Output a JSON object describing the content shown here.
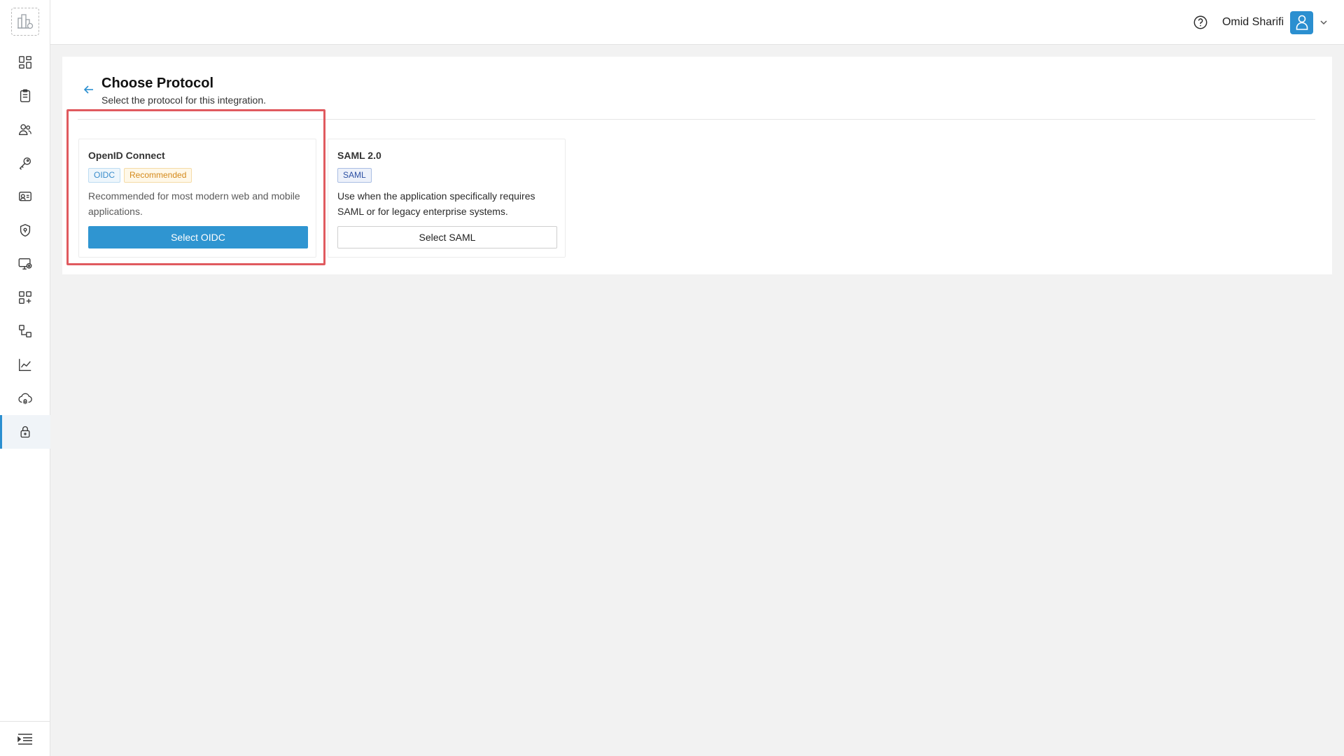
{
  "header": {
    "user_name": "Omid Sharifi",
    "icons": {
      "help": "help-circle-icon",
      "avatar": "user-icon",
      "menu": "chevron-down-icon"
    }
  },
  "sidebar": {
    "logo_icon": "building-logo-icon",
    "items": [
      {
        "icon": "dashboard-icon"
      },
      {
        "icon": "clipboard-icon"
      },
      {
        "icon": "users-icon"
      },
      {
        "icon": "key-icon"
      },
      {
        "icon": "identity-card-icon"
      },
      {
        "icon": "shield-icon"
      },
      {
        "icon": "monitor-settings-icon"
      },
      {
        "icon": "add-app-icon"
      },
      {
        "icon": "workflow-icon"
      },
      {
        "icon": "analytics-chart-icon"
      },
      {
        "icon": "cloud-fingerprint-icon"
      },
      {
        "icon": "lock-icon",
        "active": true
      }
    ],
    "collapse_icon": "collapse-menu-icon"
  },
  "page": {
    "title": "Choose Protocol",
    "subtitle": "Select the protocol for this integration.",
    "back_icon": "arrow-left-icon"
  },
  "protocols": [
    {
      "title": "OpenID Connect",
      "tags": [
        "OIDC",
        "Recommended"
      ],
      "description": "Recommended for most modern web and mobile applications.",
      "button_label": "Select OIDC",
      "highlighted": true
    },
    {
      "title": "SAML 2.0",
      "tags": [
        "SAML"
      ],
      "description": "Use when the application specifically requires SAML or for legacy enterprise systems.",
      "button_label": "Select SAML"
    }
  ],
  "colors": {
    "accent": "#2b8fd0",
    "primary_button": "#2f95d1",
    "highlight_border": "#e05a5f",
    "background": "#f2f2f2"
  }
}
